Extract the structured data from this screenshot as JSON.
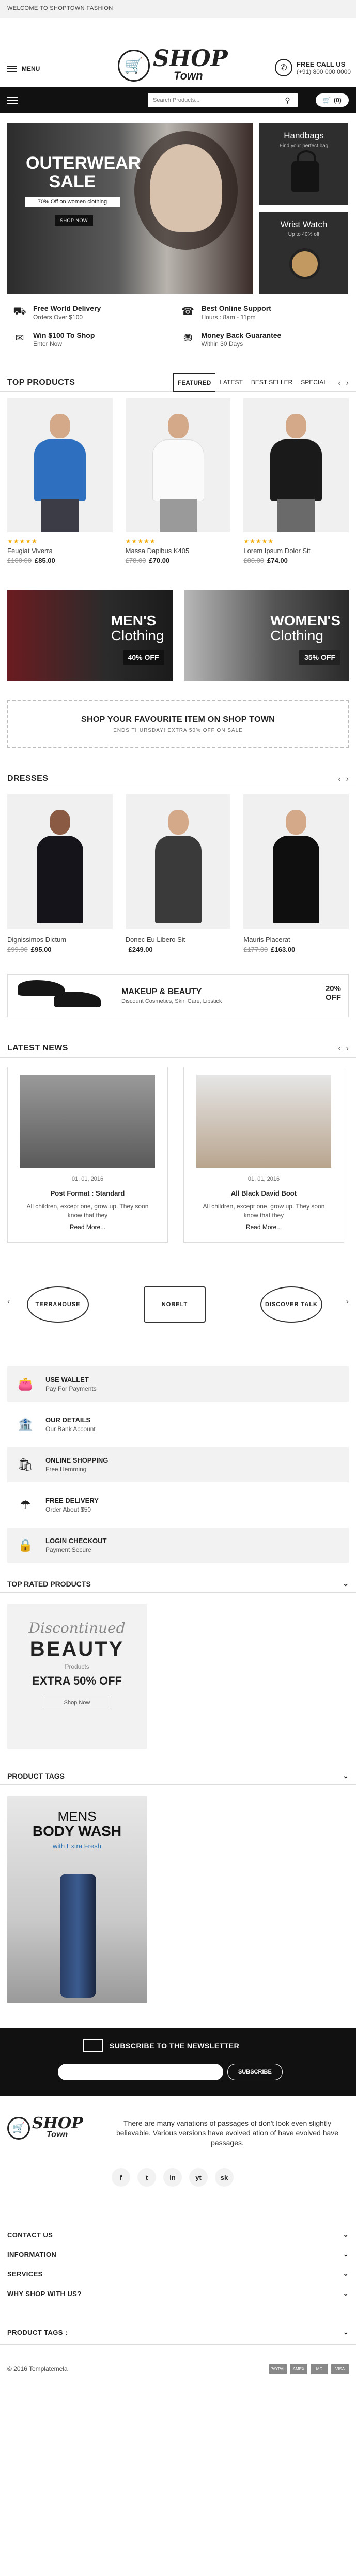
{
  "topbar": {
    "welcome": "WELCOME TO SHOPTOWN FASHION"
  },
  "header": {
    "menu_label": "MENU",
    "logo_main": "SHOP",
    "logo_sub": "Town",
    "call_title": "FREE CALL US",
    "call_number": "(+91) 800 000 0000"
  },
  "nav": {
    "search_placeholder": "Search Products...",
    "cart_count": "(0)"
  },
  "hero": {
    "title": "OUTERWEAR SALE",
    "subtitle": "70% Off on women clothing",
    "button": "SHOP NOW",
    "side1_title": "Handbags",
    "side1_sub": "Find your perfect bag",
    "side2_title": "Wrist Watch",
    "side2_sub": "Up to 40% off"
  },
  "features": [
    {
      "icon": "truck-icon",
      "title": "Free World Delivery",
      "sub": "Orders Over $100"
    },
    {
      "icon": "headset-icon",
      "title": "Best Online Support",
      "sub": "Hours : 8am - 11pm"
    },
    {
      "icon": "gift-icon",
      "title": "Win $100 To Shop",
      "sub": "Enter Now"
    },
    {
      "icon": "money-icon",
      "title": "Money Back Guarantee",
      "sub": "Within 30 Days"
    }
  ],
  "top_products": {
    "title": "TOP PRODUCTS",
    "tabs": [
      "FEATURED",
      "LATEST",
      "BEST SELLER",
      "SPECIAL"
    ],
    "items": [
      {
        "name": "Feugiat Viverra",
        "old": "£100.00",
        "new": "£85.00",
        "stars": "★★★★★",
        "color": "#2f6fc0"
      },
      {
        "name": "Massa Dapibus K405",
        "old": "£78.00",
        "new": "£70.00",
        "stars": "★★★★★",
        "color": "#f6f6f6"
      },
      {
        "name": "Lorem Ipsum Dolor Sit",
        "old": "£88.00",
        "new": "£74.00",
        "stars": "★★★★★",
        "color": "#1a1a1a"
      }
    ]
  },
  "clothing": {
    "men_a": "MEN'S",
    "men_b": "Clothing",
    "men_off": "40% OFF",
    "women_a": "WOMEN'S",
    "women_b": "Clothing",
    "women_off": "35% OFF"
  },
  "favourite": {
    "title": "SHOP YOUR FAVOURITE ITEM ON SHOP TOWN",
    "sub": "ENDS THURSDAY! EXTRA 50% OFF ON SALE"
  },
  "dresses": {
    "title": "DRESSES",
    "items": [
      {
        "name": "Dignissimos Dictum",
        "old": "£99.00",
        "new": "£95.00",
        "color": "#15141a"
      },
      {
        "name": "Donec Eu Libero Sit",
        "old": "",
        "new": "£249.00",
        "color": "#3a3a3a"
      },
      {
        "name": "Mauris Placerat",
        "old": "£177.00",
        "new": "£163.00",
        "color": "#0f0f0f"
      }
    ]
  },
  "makeup": {
    "title": "MAKEUP & BEAUTY",
    "sub": "Discount Cosmetics, Skin Care, Lipstick",
    "off_a": "20%",
    "off_b": "OFF"
  },
  "news": {
    "title": "LATEST NEWS",
    "items": [
      {
        "date": "01, 01, 2016",
        "title": "Post Format : Standard",
        "text": "All children, except one, grow up. They soon know that they",
        "more": "Read More..."
      },
      {
        "date": "01, 01, 2016",
        "title": "All Black David Boot",
        "text": "All children, except one, grow up. They soon know that they",
        "more": "Read More..."
      }
    ]
  },
  "brands": [
    {
      "name": "TERRAHOUSE"
    },
    {
      "name": "NOBELT"
    },
    {
      "name": "DISCOVER TALK"
    }
  ],
  "services": [
    {
      "icon": "wallet-icon",
      "title": "USE WALLET",
      "sub": "Pay For Payments"
    },
    {
      "icon": "bank-icon",
      "title": "OUR DETAILS",
      "sub": "Our Bank Account"
    },
    {
      "icon": "bag-icon",
      "title": "ONLINE SHOPPING",
      "sub": "Free Hemming"
    },
    {
      "icon": "box-icon",
      "title": "FREE DELIVERY",
      "sub": "Order About $50"
    },
    {
      "icon": "lock-icon",
      "title": "LOGIN CHECKOUT",
      "sub": "Payment Secure"
    }
  ],
  "sidebars": {
    "top_rated": "TOP RATED PRODUCTS",
    "tags": "PRODUCT TAGS"
  },
  "beauty": {
    "disc": "Discontinued",
    "title": "BEAUTY",
    "products": "Products",
    "offer": "EXTRA 50% OFF",
    "button": "Shop Now"
  },
  "bodywash": {
    "line1": "MENS",
    "line2": "BODY WASH",
    "sub": "with Extra Fresh"
  },
  "newsletter": {
    "title": "SUBSCRIBE TO THE NEWSLETTER",
    "button": "SUBSCRIBE"
  },
  "footer": {
    "about": "There are many variations of passages of don't look even slightly believable. Various versions have evolved ation of have evolved have passages.",
    "social": [
      "f",
      "t",
      "in",
      "yt",
      "sk"
    ],
    "links": [
      "CONTACT US",
      "INFORMATION",
      "SERVICES",
      "WHY SHOP WITH US?"
    ],
    "tags": "PRODUCT TAGS :",
    "copyright": "© 2016 Templatemela",
    "payments": [
      "PAYPAL",
      "AMEX",
      "MC",
      "VISA"
    ]
  }
}
